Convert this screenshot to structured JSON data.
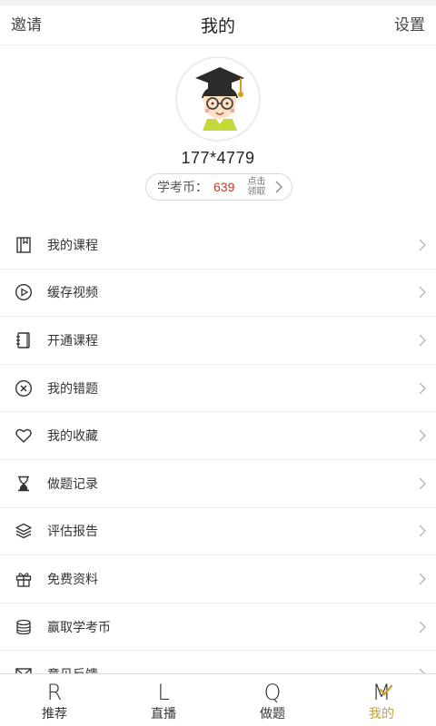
{
  "header": {
    "left_label": "邀请",
    "title": "我的",
    "right_label": "设置"
  },
  "profile": {
    "username": "177*4779",
    "coin_label": "学考币：",
    "coin_value": "639",
    "claim_line1": "点击",
    "claim_line2": "领取"
  },
  "menu": {
    "items": [
      {
        "label": "我的课程",
        "icon": "book-icon"
      },
      {
        "label": "缓存视频",
        "icon": "play-circle-icon"
      },
      {
        "label": "开通课程",
        "icon": "notebook-icon"
      },
      {
        "label": "我的错题",
        "icon": "x-circle-icon"
      },
      {
        "label": "我的收藏",
        "icon": "heart-icon"
      },
      {
        "label": "做题记录",
        "icon": "hourglass-icon"
      },
      {
        "label": "评估报告",
        "icon": "layers-icon"
      },
      {
        "label": "免费资料",
        "icon": "gift-icon"
      },
      {
        "label": "赢取学考币",
        "icon": "coin-stack-icon"
      },
      {
        "label": "意见反馈",
        "icon": "mail-icon"
      }
    ]
  },
  "tabbar": {
    "tabs": [
      {
        "glyph": "R",
        "label": "推荐"
      },
      {
        "glyph": "L",
        "label": "直播"
      },
      {
        "glyph": "Q",
        "label": "做题"
      },
      {
        "glyph": "M",
        "label": "我的"
      }
    ],
    "active_index": 3
  },
  "colors": {
    "coin_value": "#c0392b",
    "active_tab": "#c9a227"
  }
}
